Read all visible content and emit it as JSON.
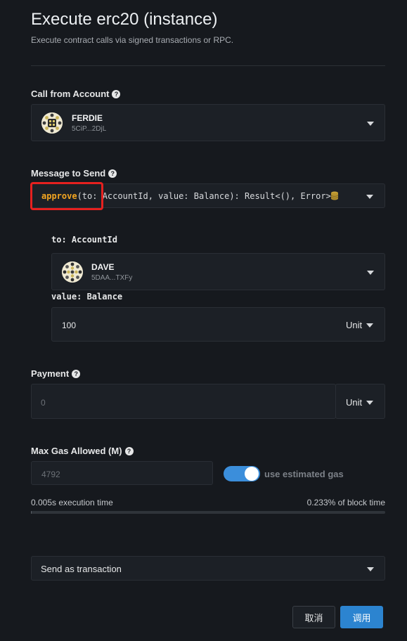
{
  "header": {
    "title": "Execute erc20 (instance)",
    "subtitle": "Execute contract calls via signed transactions or RPC."
  },
  "call_from": {
    "label": "Call from Account",
    "account_name": "FERDIE",
    "account_address": "5CiP...2DjL"
  },
  "message": {
    "label": "Message to Send",
    "fn_name": "approve",
    "signature": "(to: AccountId, value: Balance): Result<(), Error>",
    "icon": "database-icon"
  },
  "args": {
    "to_label": "to: AccountId",
    "to_account_name": "DAVE",
    "to_account_address": "5DAA...TXFy",
    "value_label": "value: Balance",
    "value": "100",
    "value_unit": "Unit"
  },
  "payment": {
    "label": "Payment",
    "placeholder": "0",
    "unit": "Unit"
  },
  "gas": {
    "label": "Max Gas Allowed (M)",
    "placeholder": "4792",
    "use_estimated_label": "use estimated gas",
    "use_estimated_enabled": true,
    "execution_time": "0.005s execution time",
    "block_time": "0.233% of block time",
    "block_usage_fraction": 0.00233
  },
  "send": {
    "mode": "Send as transaction"
  },
  "buttons": {
    "cancel": "取消",
    "call": "调用"
  },
  "colors": {
    "background": "#16191e",
    "accent": "#2c84d0",
    "function_name": "#f4a621",
    "highlight": "#e6211f"
  }
}
